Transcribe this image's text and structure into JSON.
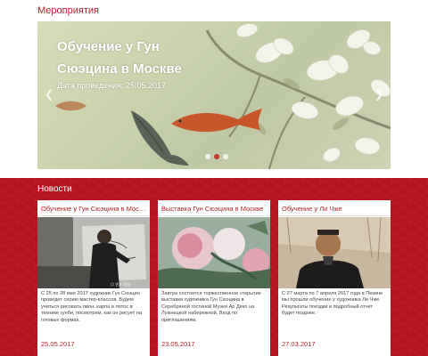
{
  "events": {
    "title": "Мероприятия",
    "slide": {
      "title": "Обучение у Гун Сюэцина в Москве",
      "date_text": "Дата проведения: 25.05.2017"
    },
    "prev_icon": "chevron-left-icon",
    "next_icon": "chevron-right-icon",
    "dots_count": 3,
    "active_dot": 1
  },
  "news": {
    "title": "Новости",
    "cards": [
      {
        "title": "Обучение у Гун Сюэцина в Москве",
        "text": "С 25 по 28 мая 2017 художник Гун Сюэцин проведет серию мастер-классов. Будем учиться рисовать пион, карпа и лотос в технике гунби, посмотрим, как он рисует на готовых формах.",
        "date": "25.05.2017"
      },
      {
        "title": "Выставка Гун Сюэцина в Москве",
        "text": "Завтра состоится торжественное открытие выставки художника Гун Сюэцина в Серебряной гостиной Музея Ар Деко на Лужнецкой набережной. Вход по приглашениям.",
        "date": "23.05.2017"
      },
      {
        "title": "Обучение у Ли Чже",
        "text": "С 27 марта по 7 апреля 2017 года в Пекине мы прошли обучение у художника Ли Чже. Результаты поездки и подробный отчет будет позднее.",
        "date": "27.03.2017"
      }
    ]
  },
  "colors": {
    "accent": "#b0242c",
    "news_background": "#b5141f"
  }
}
